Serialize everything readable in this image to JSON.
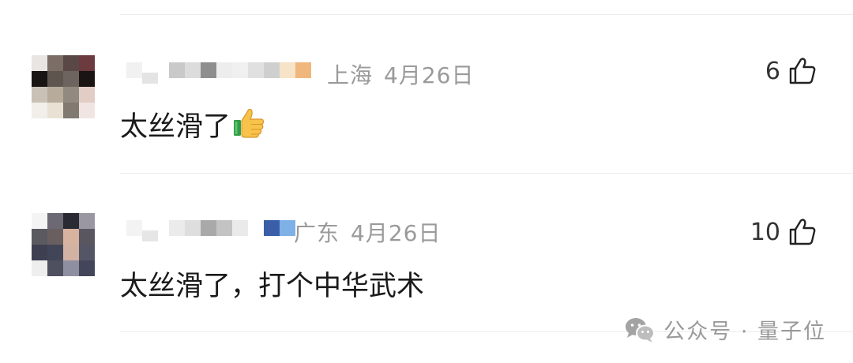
{
  "comments": [
    {
      "location": "上海",
      "date": "4月26日",
      "text": "太丝滑了",
      "emoji": "thumbs-up",
      "likes": "6"
    },
    {
      "location": "广东",
      "date": "4月26日",
      "text": "太丝滑了，打个中华武术",
      "likes": "10"
    }
  ],
  "watermark": {
    "label": "公众号 · 量子位",
    "icon": "wechat-icon"
  },
  "colors": {
    "meta_text": "#9a9a9a",
    "body_text": "#1a1a1a",
    "divider": "#ececec"
  }
}
